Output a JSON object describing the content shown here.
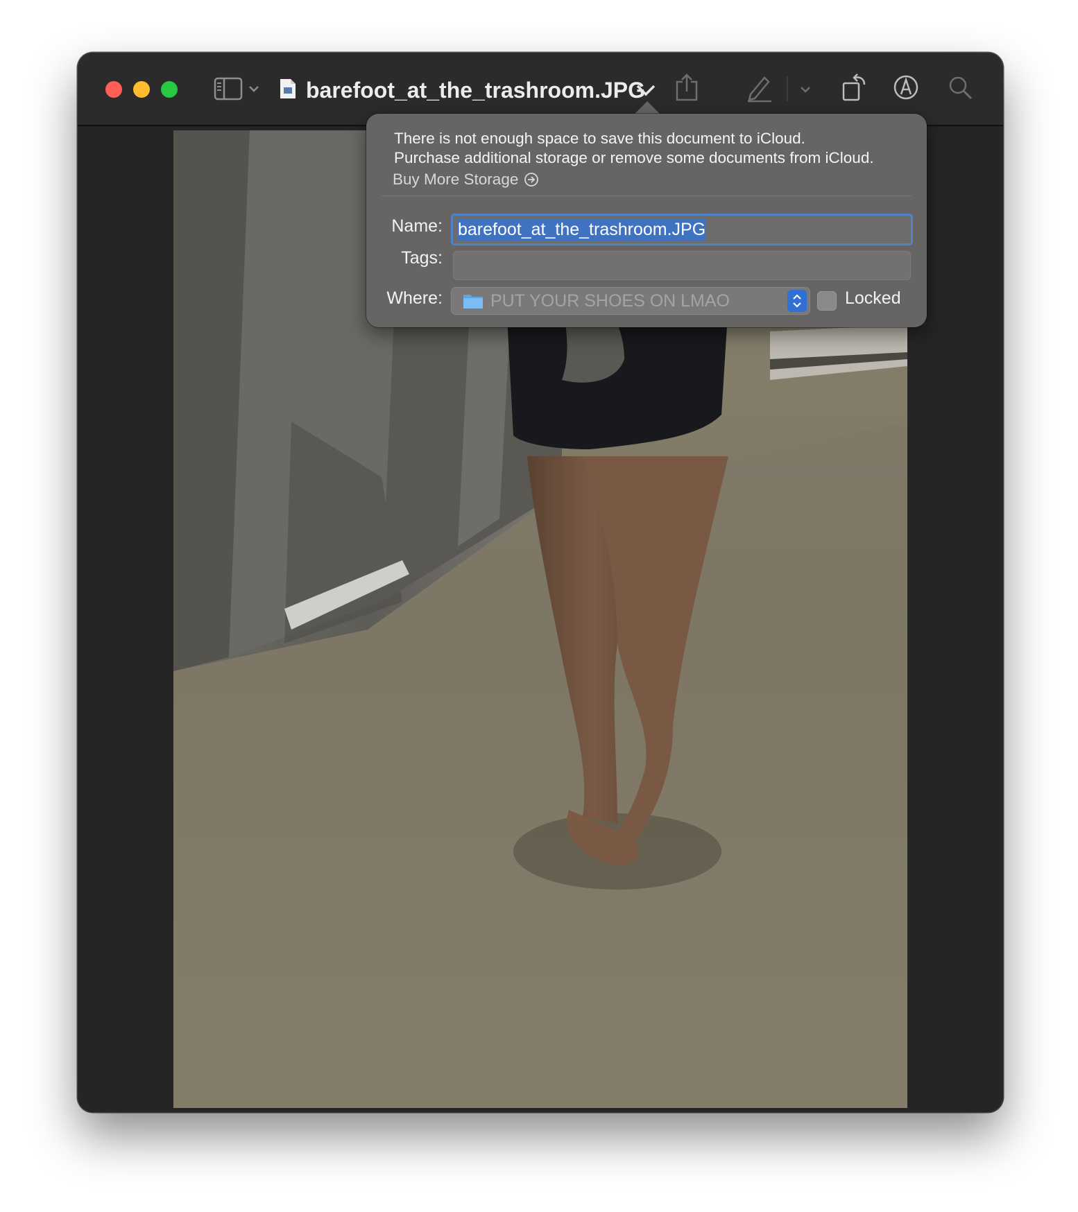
{
  "window": {
    "title": "barefoot_at_the_trashroom.JPG",
    "toolbar_icons": [
      "sidebar-toggle-icon",
      "chevron-down-icon",
      "document-icon",
      "share-icon",
      "markup-pencil-icon",
      "rotate-icon",
      "annotate-icon",
      "search-icon"
    ]
  },
  "popover": {
    "message_line1": "There is not enough space to save this document to iCloud.",
    "message_line2": "Purchase additional storage or remove some documents from iCloud.",
    "buy_link": "Buy More Storage",
    "name_label": "Name:",
    "name_value": "barefoot_at_the_trashroom.JPG",
    "tags_label": "Tags:",
    "tags_value": "",
    "where_label": "Where:",
    "where_value": "PUT YOUR SHOES ON LMAO",
    "locked_label": "Locked",
    "locked_checked": false
  },
  "colors": {
    "accent": "#3f73c2",
    "window_bg": "#252525",
    "popover_bg": "#666564"
  }
}
